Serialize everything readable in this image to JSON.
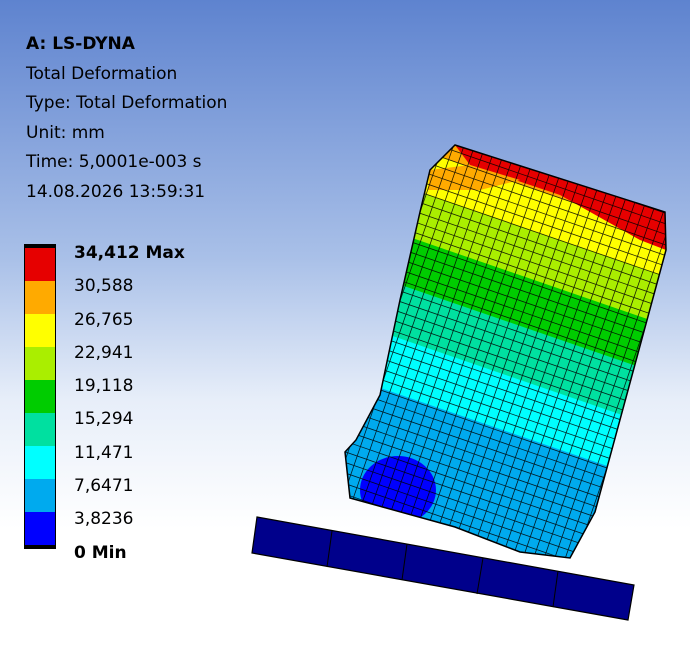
{
  "header": {
    "title": "A: LS-DYNA",
    "result_name": "Total Deformation",
    "type": "Type: Total Deformation",
    "unit": "Unit: mm",
    "time": "Time: 5,0001e-003 s",
    "datetime": "14.08.2026 13:59:31"
  },
  "legend": {
    "max_label": "34,412 Max",
    "min_label": "0 Min",
    "values": [
      "30,588",
      "26,765",
      "22,941",
      "19,118",
      "15,294",
      "11,471",
      "7,6471",
      "3,8236"
    ],
    "colors": [
      "#e60000",
      "#ffaa00",
      "#ffff00",
      "#aaee00",
      "#00cc00",
      "#00e0a0",
      "#00ffff",
      "#00aaee",
      "#0000ff"
    ],
    "cap_color": "#000000"
  },
  "model": {
    "floor_color": "#00008b",
    "mesh_line_color": "#000000"
  }
}
